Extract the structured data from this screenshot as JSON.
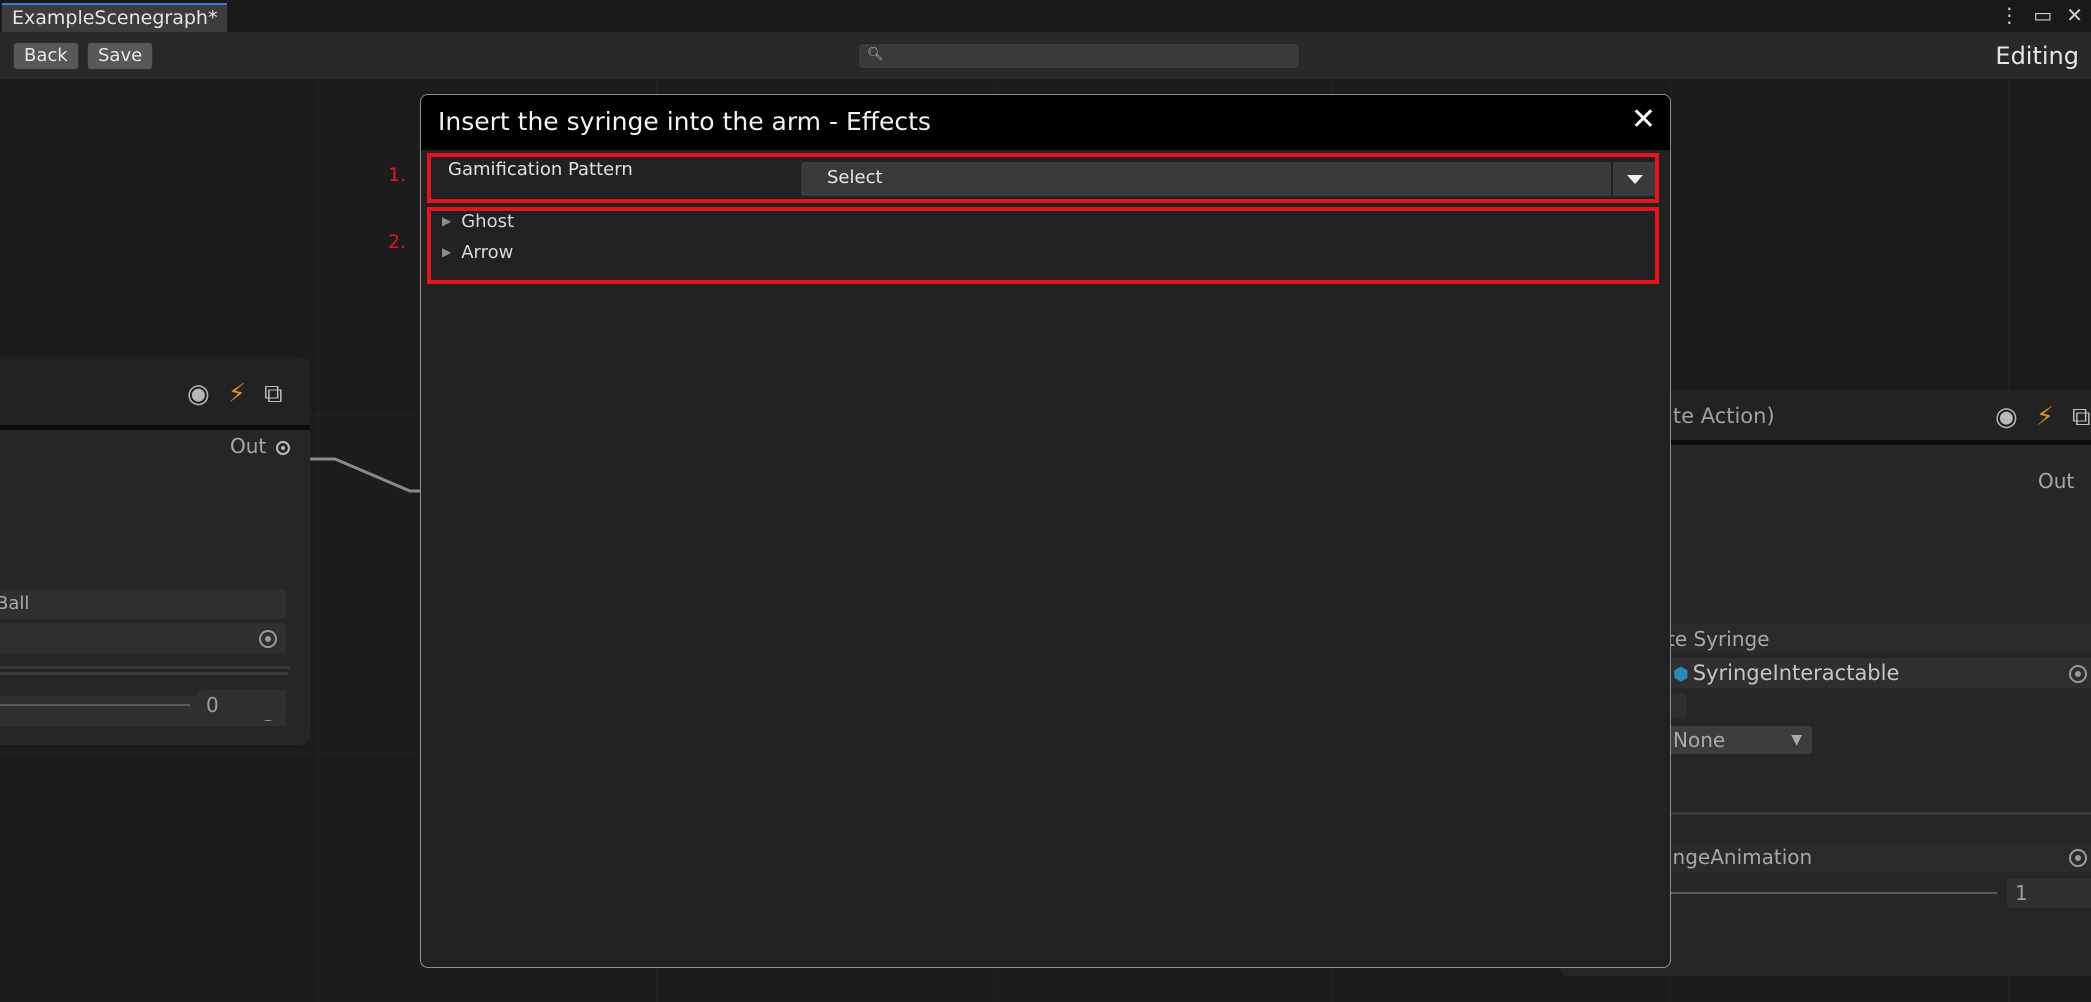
{
  "tab": {
    "title": "ExampleScenegraph*"
  },
  "window_icons": {
    "menu": "⋮",
    "maximize": "▭",
    "close": "✕"
  },
  "toolbar": {
    "back_label": "Back",
    "save_label": "Save",
    "search_placeholder": "",
    "search_value": "",
    "mode_label": "Editing"
  },
  "left_node": {
    "out_label": "Out",
    "field1_value": "Ball",
    "slider_value": "0"
  },
  "right_node": {
    "title_fragment": "ate Action)",
    "out_label": "Out",
    "label1": "te Syringe",
    "object_ref": "SyringeInteractable",
    "select_value": "None",
    "label2": "ingeAnimation",
    "slider_value": "1"
  },
  "modal": {
    "title": "Insert the syringe into the arm - Effects",
    "close_icon": "close-icon",
    "row_label": "Gamification Pattern",
    "dropdown_value": "Select",
    "tree_items": [
      "Ghost",
      "Arrow"
    ]
  },
  "annotations": {
    "label1": "1.",
    "label2": "2.",
    "color": "#e0161f"
  }
}
